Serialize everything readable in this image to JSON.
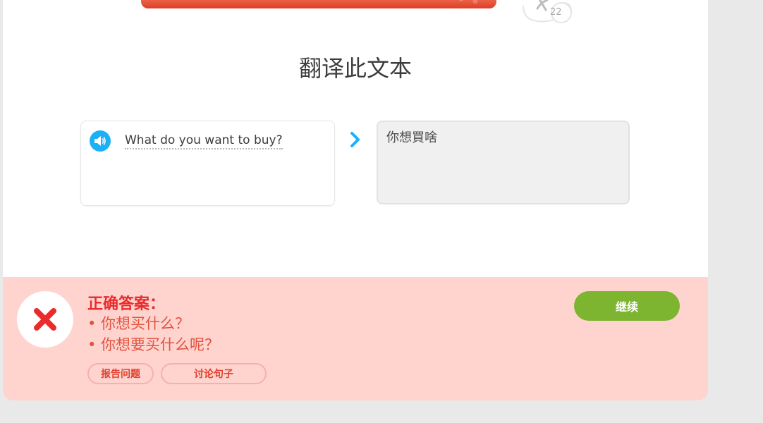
{
  "lesson": {
    "progress_fraction": 0.84,
    "badge_count": "22"
  },
  "page_title": "翻译此文本",
  "source": {
    "sentence": "What do you want to buy?"
  },
  "answer": {
    "value": "你想買啥"
  },
  "feedback": {
    "heading": "正确答案：",
    "correct_answers": [
      "• 你想买什么？",
      "• 你想要买什么呢？"
    ],
    "report_label": "报告问题",
    "discuss_label": "讨论句子",
    "continue_label": "继续"
  },
  "colors": {
    "accent_blue": "#1cb0f6",
    "error_red": "#ea2b2b",
    "feedback_bg": "#ffd3ce",
    "continue_green": "#7eb530"
  }
}
